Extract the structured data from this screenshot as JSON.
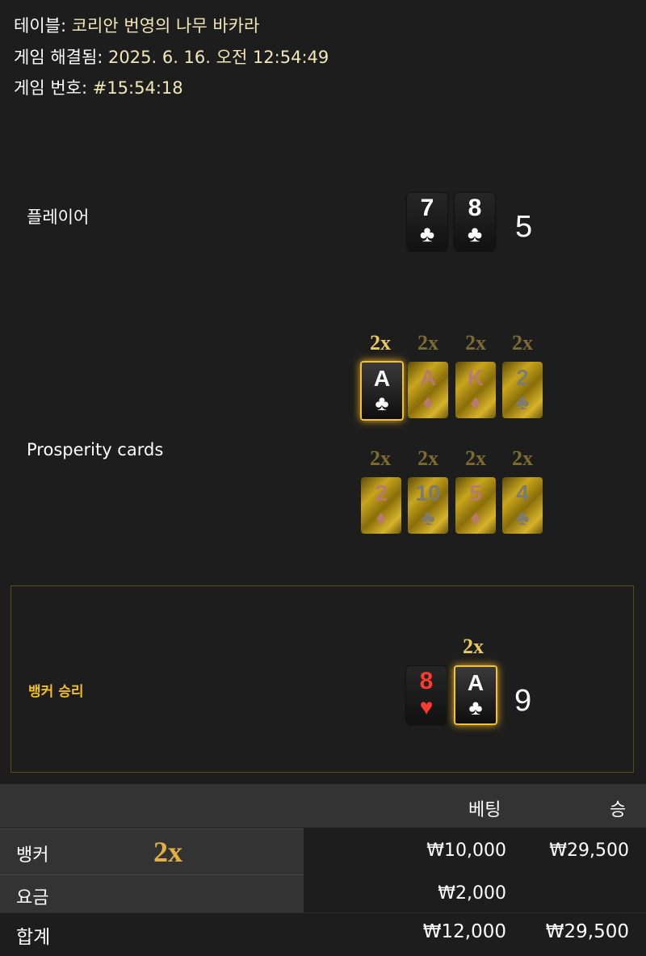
{
  "meta": {
    "table_label": "테이블:",
    "table_value": "코리안 번영의 나무 바카라",
    "resolved_label": "게임 해결됨:",
    "resolved_value": "2025. 6. 16. 오전 12:54:49",
    "game_no_label": "게임 번호:",
    "game_no_value": "#15:54:18"
  },
  "player": {
    "label": "플레이어",
    "cards": [
      {
        "rank": "7",
        "suit": "♣"
      },
      {
        "rank": "8",
        "suit": "♣"
      }
    ],
    "score": "5"
  },
  "prosperity": {
    "label": "Prosperity cards",
    "row1": [
      {
        "mult": "2x",
        "rank": "A",
        "suit": "♣",
        "color": "black",
        "selected": true
      },
      {
        "mult": "2x",
        "rank": "A",
        "suit": "♦",
        "color": "red",
        "selected": false
      },
      {
        "mult": "2x",
        "rank": "K",
        "suit": "♦",
        "color": "red",
        "selected": false
      },
      {
        "mult": "2x",
        "rank": "2",
        "suit": "♣",
        "color": "black",
        "selected": false
      }
    ],
    "row2": [
      {
        "mult": "2x",
        "rank": "2",
        "suit": "♦",
        "color": "red",
        "selected": false
      },
      {
        "mult": "2x",
        "rank": "10",
        "suit": "♣",
        "color": "black",
        "selected": false
      },
      {
        "mult": "2x",
        "rank": "5",
        "suit": "♦",
        "color": "red",
        "selected": false
      },
      {
        "mult": "2x",
        "rank": "4",
        "suit": "♣",
        "color": "black",
        "selected": false
      }
    ]
  },
  "banker": {
    "result_label": "뱅커 승리",
    "cards": [
      {
        "rank": "8",
        "suit": "♥",
        "color": "red",
        "mult": ""
      },
      {
        "rank": "A",
        "suit": "♣",
        "color": "black",
        "mult": "2x"
      }
    ],
    "score": "9"
  },
  "bets": {
    "headers": {
      "bet": "베팅",
      "win": "승"
    },
    "rows": [
      {
        "name": "뱅커",
        "multiplier": "2x",
        "bet": "₩10,000",
        "win": "₩29,500"
      },
      {
        "name": "요금",
        "multiplier": "",
        "bet": "₩2,000",
        "win": ""
      }
    ],
    "total": {
      "name": "합계",
      "bet": "₩12,000",
      "win": "₩29,500"
    }
  },
  "colors": {
    "accent": "#f0c020",
    "gold_text": "#f2e7b8",
    "background": "#1d1d1d"
  }
}
